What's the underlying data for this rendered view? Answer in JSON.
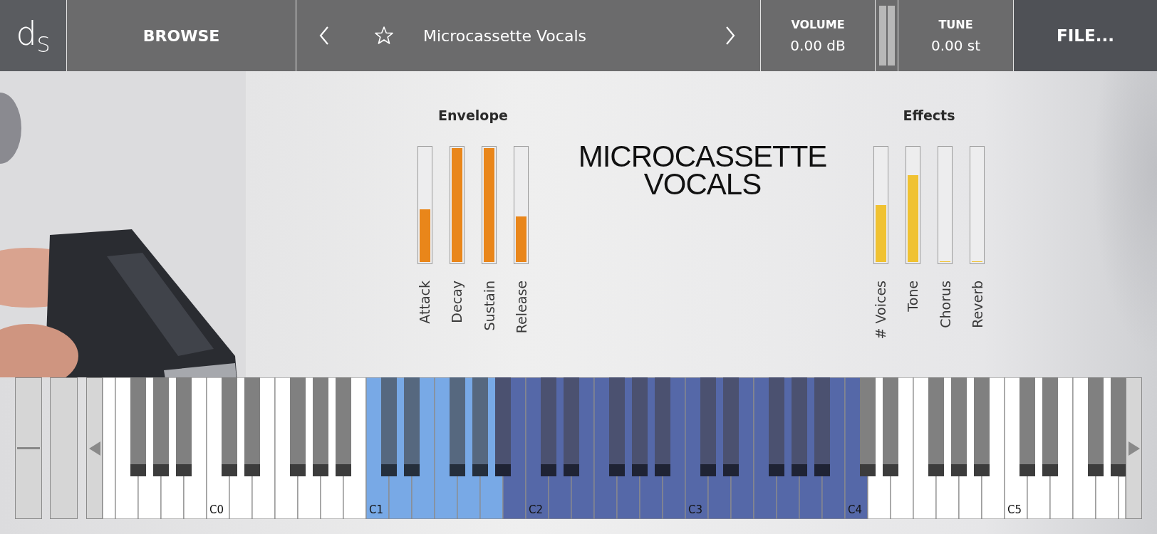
{
  "header": {
    "logo": "d$_{S}$",
    "browse": "BROWSE",
    "preset": {
      "favorite": false,
      "name": "Microcassette Vocals"
    },
    "volume": {
      "label": "VOLUME",
      "value": "0.00 dB"
    },
    "tune": {
      "label": "TUNE",
      "value": "0.00 st"
    },
    "file": "FILE..."
  },
  "envelope": {
    "title": "Envelope",
    "sliders": [
      {
        "label": "Attack",
        "level": 0.46
      },
      {
        "label": "Decay",
        "level": 1
      },
      {
        "label": "Sustain",
        "level": 1
      },
      {
        "label": "Release",
        "level": 0.4
      }
    ]
  },
  "patch_title": [
    "MICROCASSETTE",
    "VOCALS"
  ],
  "effects": {
    "title": "Effects",
    "sliders": [
      {
        "label": "# Voices",
        "level": 0.5
      },
      {
        "label": "Tone",
        "level": 0.76
      },
      {
        "label": "Chorus",
        "level": 0
      },
      {
        "label": "Reverb",
        "level": 0
      }
    ]
  },
  "keyboard": {
    "keys": [
      {
        "kind": "white",
        "color": "#ffffff"
      },
      {
        "kind": "white",
        "color": "#ffffff"
      },
      {
        "kind": "black",
        "color": "#808080"
      },
      {
        "kind": "white",
        "color": "#ffffff"
      },
      {
        "kind": "black",
        "color": "#808080"
      },
      {
        "kind": "white",
        "color": "#ffffff"
      },
      {
        "kind": "black",
        "color": "#808080"
      },
      {
        "kind": "white",
        "color": "#ffffff"
      },
      {
        "kind": "white",
        "color": "#ffffff",
        "label": "C0"
      },
      {
        "kind": "black",
        "color": "#808080"
      },
      {
        "kind": "white",
        "color": "#ffffff"
      },
      {
        "kind": "black",
        "color": "#808080"
      },
      {
        "kind": "white",
        "color": "#ffffff"
      },
      {
        "kind": "white",
        "color": "#ffffff"
      },
      {
        "kind": "black",
        "color": "#808080"
      },
      {
        "kind": "white",
        "color": "#ffffff"
      },
      {
        "kind": "black",
        "color": "#808080"
      },
      {
        "kind": "white",
        "color": "#ffffff"
      },
      {
        "kind": "black",
        "color": "#808080"
      },
      {
        "kind": "white",
        "color": "#ffffff"
      },
      {
        "kind": "white",
        "color": "#78a9e6",
        "label": "C1"
      },
      {
        "kind": "black",
        "color": "#56687f"
      },
      {
        "kind": "white",
        "color": "#78a9e6"
      },
      {
        "kind": "black",
        "color": "#56687f"
      },
      {
        "kind": "white",
        "color": "#78a9e6"
      },
      {
        "kind": "white",
        "color": "#78a9e6"
      },
      {
        "kind": "black",
        "color": "#56687f"
      },
      {
        "kind": "white",
        "color": "#78a9e6"
      },
      {
        "kind": "black",
        "color": "#56687f"
      },
      {
        "kind": "white",
        "color": "#78a9e6"
      },
      {
        "kind": "black",
        "color": "#4b5170"
      },
      {
        "kind": "white",
        "color": "#5568a8"
      },
      {
        "kind": "white",
        "color": "#5568a8",
        "label": "C2"
      },
      {
        "kind": "black",
        "color": "#4b5170"
      },
      {
        "kind": "white",
        "color": "#5568a8"
      },
      {
        "kind": "black",
        "color": "#4b5170"
      },
      {
        "kind": "white",
        "color": "#5568a8"
      },
      {
        "kind": "white",
        "color": "#5568a8"
      },
      {
        "kind": "black",
        "color": "#4b5170"
      },
      {
        "kind": "white",
        "color": "#5568a8"
      },
      {
        "kind": "black",
        "color": "#4b5170"
      },
      {
        "kind": "white",
        "color": "#5568a8"
      },
      {
        "kind": "black",
        "color": "#4b5170"
      },
      {
        "kind": "white",
        "color": "#5568a8"
      },
      {
        "kind": "white",
        "color": "#5568a8",
        "label": "C3"
      },
      {
        "kind": "black",
        "color": "#4b5170"
      },
      {
        "kind": "white",
        "color": "#5568a8"
      },
      {
        "kind": "black",
        "color": "#4b5170"
      },
      {
        "kind": "white",
        "color": "#5568a8"
      },
      {
        "kind": "white",
        "color": "#5568a8"
      },
      {
        "kind": "black",
        "color": "#4b5170"
      },
      {
        "kind": "white",
        "color": "#5568a8"
      },
      {
        "kind": "black",
        "color": "#4b5170"
      },
      {
        "kind": "white",
        "color": "#5568a8"
      },
      {
        "kind": "black",
        "color": "#4b5170"
      },
      {
        "kind": "white",
        "color": "#5568a8"
      },
      {
        "kind": "white",
        "color": "#5568a8",
        "label": "C4"
      },
      {
        "kind": "black",
        "color": "#808080"
      },
      {
        "kind": "white",
        "color": "#ffffff"
      },
      {
        "kind": "black",
        "color": "#808080"
      },
      {
        "kind": "white",
        "color": "#ffffff"
      },
      {
        "kind": "white",
        "color": "#ffffff"
      },
      {
        "kind": "black",
        "color": "#808080"
      },
      {
        "kind": "white",
        "color": "#ffffff"
      },
      {
        "kind": "black",
        "color": "#808080"
      },
      {
        "kind": "white",
        "color": "#ffffff"
      },
      {
        "kind": "black",
        "color": "#808080"
      },
      {
        "kind": "white",
        "color": "#ffffff"
      },
      {
        "kind": "white",
        "color": "#ffffff",
        "label": "C5"
      },
      {
        "kind": "black",
        "color": "#808080"
      },
      {
        "kind": "white",
        "color": "#ffffff"
      },
      {
        "kind": "black",
        "color": "#808080"
      },
      {
        "kind": "white",
        "color": "#ffffff"
      },
      {
        "kind": "white",
        "color": "#ffffff"
      },
      {
        "kind": "black",
        "color": "#808080"
      },
      {
        "kind": "white",
        "color": "#ffffff"
      },
      {
        "kind": "black",
        "color": "#808080"
      },
      {
        "kind": "white",
        "color": "#ffffff"
      }
    ]
  }
}
